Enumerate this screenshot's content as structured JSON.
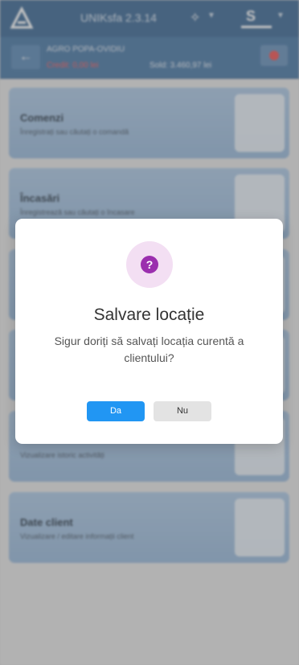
{
  "app": {
    "title": "UNIKsfa 2.3.14",
    "user_initial": "S"
  },
  "client": {
    "name": "AGRO POPA-OVIDIU",
    "credit": "Credit: 0,00 lei",
    "sold": "Sold: 3.460,97 lei"
  },
  "cards": [
    {
      "title": "Comenzi",
      "subtitle": "Înregistrați sau căutați o comandă",
      "icon": "order-document-icon"
    },
    {
      "title": "Încasări",
      "subtitle": "Înregistrează sau căutați o încasare",
      "icon": "cash-icon"
    },
    {
      "title": "",
      "subtitle": "",
      "icon": "document-icon"
    },
    {
      "title": "",
      "subtitle": "",
      "icon": "document-icon"
    },
    {
      "title": "",
      "subtitle": "Vizualizare istoric activități",
      "icon": "chart-icon"
    },
    {
      "title": "Date client",
      "subtitle": "Vizualizare / editare informații client",
      "icon": "client-profile-icon"
    }
  ],
  "dialog": {
    "icon": "question-icon",
    "title": "Salvare locație",
    "message": "Sigur doriți să salvați locația curentă a clientului?",
    "yes_label": "Da",
    "no_label": "Nu"
  },
  "colors": {
    "header": "#2c5c8c",
    "accent": "#2196f3",
    "credit": "#ff4d4d",
    "question": "#9b2fae"
  }
}
